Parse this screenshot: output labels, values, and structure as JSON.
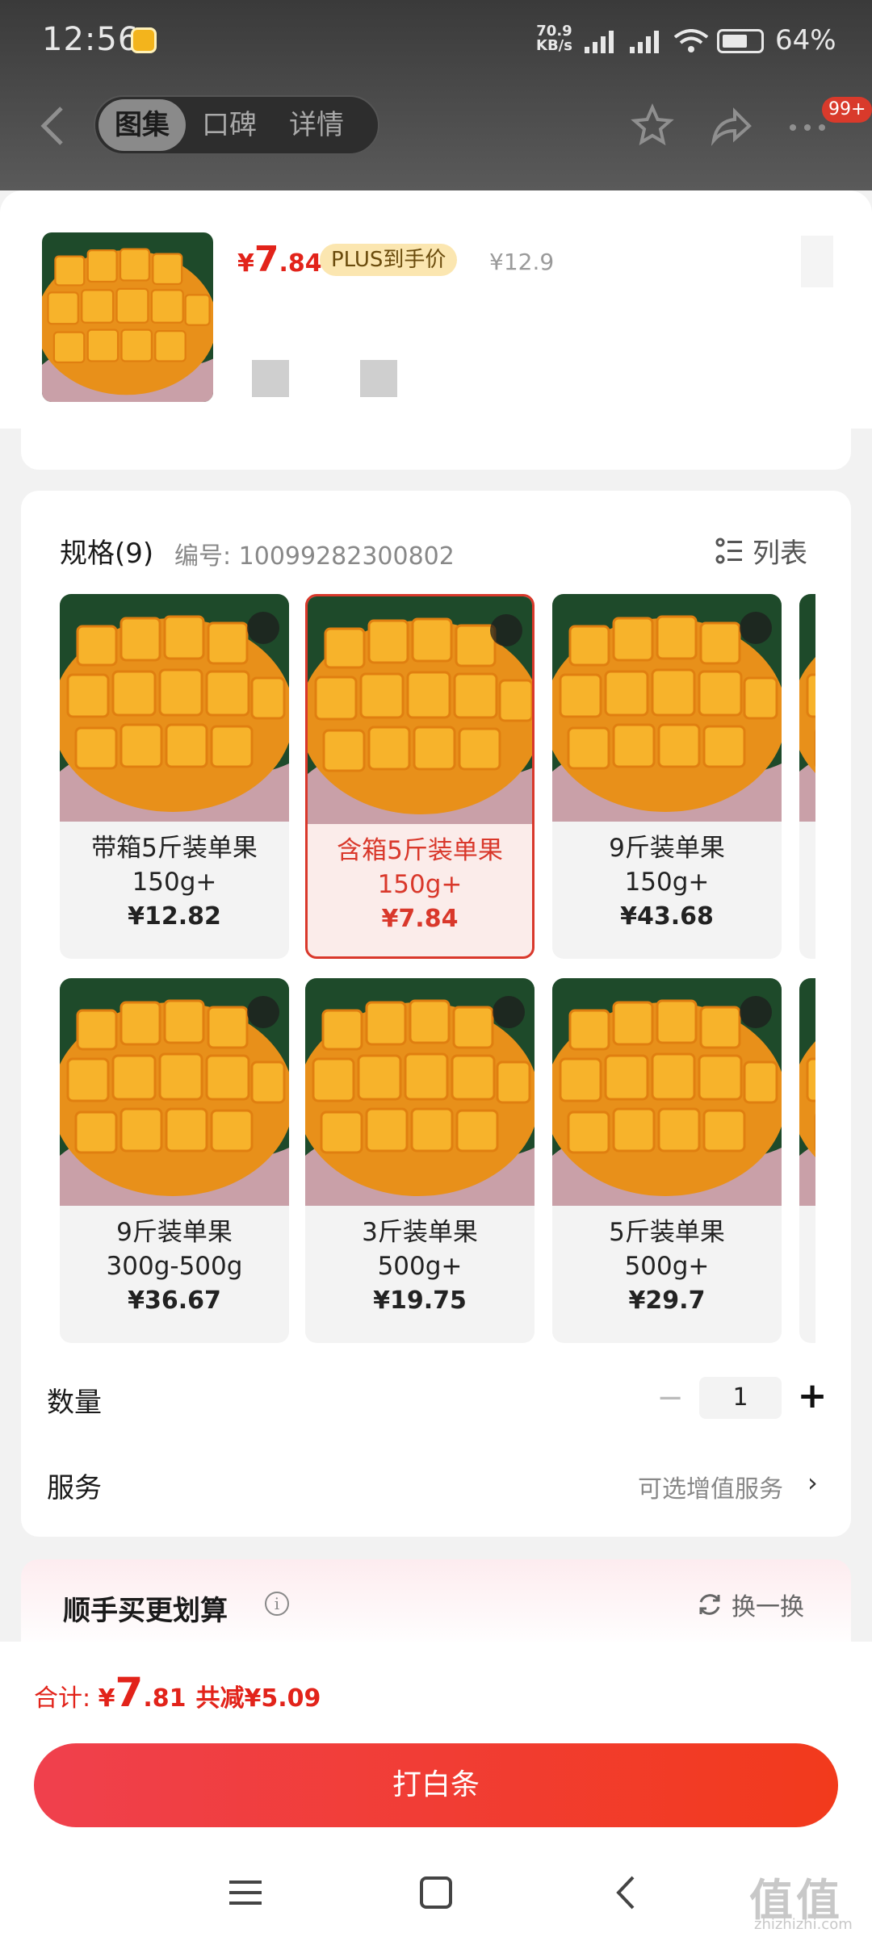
{
  "status_bar": {
    "time": "12:56",
    "speed_value": "70.9",
    "speed_unit": "KB/s",
    "battery": "64%"
  },
  "header": {
    "tabs": [
      {
        "label": "图集",
        "active": true
      },
      {
        "label": "口碑",
        "active": false
      },
      {
        "label": "详情",
        "active": false
      }
    ],
    "badge": "99+"
  },
  "product": {
    "price_symbol": "¥",
    "price_int": "7",
    "price_dec": ".84",
    "plus_tag": "PLUS到手价",
    "original_price": "¥12.9"
  },
  "spec": {
    "title": "规格(9)",
    "code": "编号: 10099282300802",
    "list_toggle": "列表",
    "items": [
      {
        "name1": "带箱5斤装单果",
        "name2": "150g+",
        "price": "¥12.82",
        "selected": false
      },
      {
        "name1": "含箱5斤装单果",
        "name2": "150g+",
        "price": "¥7.84",
        "selected": true
      },
      {
        "name1": "9斤装单果",
        "name2": "150g+",
        "price": "¥43.68",
        "selected": false
      },
      {
        "name1": "9斤装单果",
        "name2": "300g-500g",
        "price": "¥36.67",
        "selected": false
      },
      {
        "name1": "3斤装单果",
        "name2": "500g+",
        "price": "¥19.75",
        "selected": false
      },
      {
        "name1": "5斤装单果",
        "name2": "500g+",
        "price": "¥29.7",
        "selected": false
      }
    ]
  },
  "quantity": {
    "label": "数量",
    "minus": "−",
    "value": "1",
    "plus": "+"
  },
  "service": {
    "label": "服务",
    "value": "可选增值服务",
    "chevron": "›"
  },
  "combo": {
    "title": "顺手买更划算",
    "info": "i",
    "refresh": "换一换"
  },
  "footer": {
    "total_label": "合计: ",
    "total_symbol": "¥",
    "total_int": "7",
    "total_dec": ".81",
    "savings": "共减¥5.09",
    "cta_label": "打白条"
  },
  "watermark": {
    "text": "值值值",
    "sub": "zhizhizhi.com"
  },
  "colors": {
    "accent_red": "#e2231a",
    "plus_gold": "#fbe6b0",
    "mango": "#f5a623"
  },
  "icons": [
    "back-icon",
    "star-icon",
    "share-icon",
    "more-icon",
    "expand-icon",
    "list-icon",
    "info-icon",
    "refresh-icon",
    "menu-nav-icon",
    "home-nav-icon",
    "back-nav-icon"
  ]
}
